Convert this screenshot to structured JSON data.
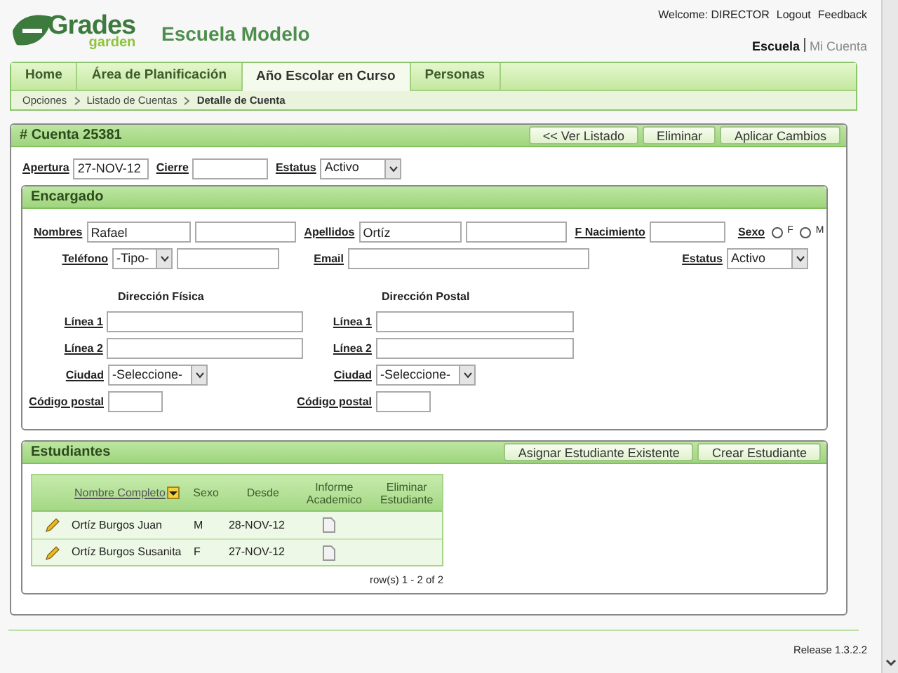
{
  "header": {
    "logo": {
      "word1": "Grades",
      "word2": "garden"
    },
    "school": "Escuela Modelo",
    "welcome": "Welcome: DIRECTOR",
    "links": [
      "Logout",
      "Feedback"
    ],
    "context": [
      {
        "label": "Escuela",
        "selected": true
      },
      {
        "label": "Mi Cuenta",
        "selected": false
      }
    ]
  },
  "tabs": [
    {
      "label": "Home",
      "selected": false
    },
    {
      "label": "Área de Planificación",
      "selected": false
    },
    {
      "label": "Año Escolar en Curso",
      "selected": true
    },
    {
      "label": "Personas",
      "selected": false
    }
  ],
  "breadcrumb": [
    "Opciones",
    "Listado de Cuentas",
    "Detalle de Cuenta"
  ],
  "account": {
    "title": "# Cuenta 25381",
    "buttons": [
      "<< Ver Listado",
      "Eliminar",
      "Aplicar Cambios"
    ],
    "fields": [
      {
        "kind": "text",
        "label": "Apertura",
        "value": "27-NOV-12"
      },
      {
        "kind": "text",
        "label": "Cierre"
      },
      {
        "kind": "select",
        "label": "Estatus",
        "value": "Activo"
      }
    ]
  },
  "guardian": {
    "title": "Encargado",
    "nombres": {
      "label": "Nombres",
      "value": "Rafael"
    },
    "apellidos": {
      "label": "Apellidos",
      "value": "Ortíz"
    },
    "nacimiento": {
      "label": "F Nacimiento"
    },
    "sexo": {
      "label": "Sexo",
      "options": [
        {
          "label": "F",
          "selected": false
        },
        {
          "label": "M",
          "selected": false
        }
      ]
    },
    "telefono": {
      "label": "Teléfono",
      "type": "-Tipo-"
    },
    "email": {
      "label": "Email"
    },
    "estatus": {
      "label": "Estatus",
      "value": "Activo"
    },
    "addresses": [
      {
        "title": "Dirección Física",
        "fields": [
          {
            "kind": "text",
            "label": "Línea 1"
          },
          {
            "kind": "text",
            "label": "Línea 2"
          },
          {
            "kind": "select",
            "label": "Ciudad",
            "value": "-Seleccione-"
          },
          {
            "kind": "short",
            "label": "Código postal"
          }
        ]
      },
      {
        "title": "Dirección Postal",
        "fields": [
          {
            "kind": "text",
            "label": "Línea 1"
          },
          {
            "kind": "text",
            "label": "Línea 2"
          },
          {
            "kind": "select",
            "label": "Ciudad",
            "value": "-Seleccione-"
          },
          {
            "kind": "short",
            "label": "Código postal"
          }
        ]
      }
    ]
  },
  "students": {
    "title": "Estudiantes",
    "buttons": [
      "Asignar Estudiante Existente",
      "Crear Estudiante"
    ],
    "columns": [
      "Nombre Completo",
      "Sexo",
      "Desde",
      "Informe Academico",
      "Eliminar Estudiante"
    ],
    "rows": [
      {
        "name": "Ortíz Burgos Juan",
        "sexo": "M",
        "desde": "28-NOV-12"
      },
      {
        "name": "Ortíz Burgos Susanita",
        "sexo": "F",
        "desde": "27-NOV-12"
      }
    ],
    "pager": "row(s) 1 - 2 of 2"
  },
  "footer": {
    "release": "Release 1.3.2.2"
  }
}
